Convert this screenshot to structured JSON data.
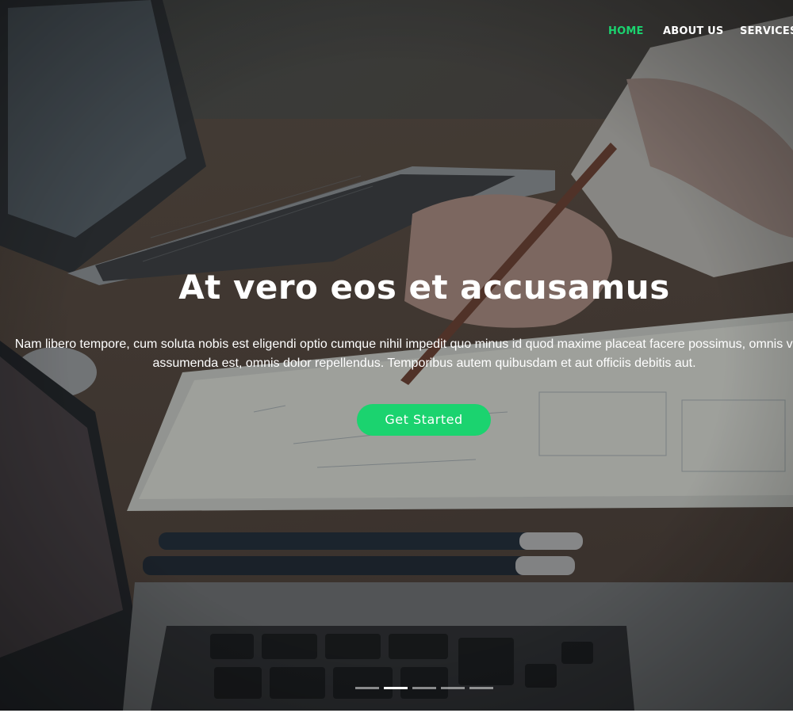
{
  "nav": {
    "items": [
      {
        "label": "HOME",
        "active": true
      },
      {
        "label": "ABOUT US",
        "active": false
      },
      {
        "label": "SERVICES",
        "active": false
      }
    ]
  },
  "hero": {
    "title": "At vero eos et accusamus",
    "text_line1": "Nam libero tempore, cum soluta nobis est eligendi optio cumque nihil impedit quo minus id quod maxime placeat facere possimus, omnis voluptas",
    "text_line2": "assumenda est, omnis dolor repellendus. Temporibus autem quibusdam et aut officiis debitis aut.",
    "cta_label": "Get Started"
  },
  "carousel": {
    "slide_count": 5,
    "active_index": 1
  },
  "colors": {
    "accent": "#1bd36f",
    "text": "#ffffff"
  }
}
